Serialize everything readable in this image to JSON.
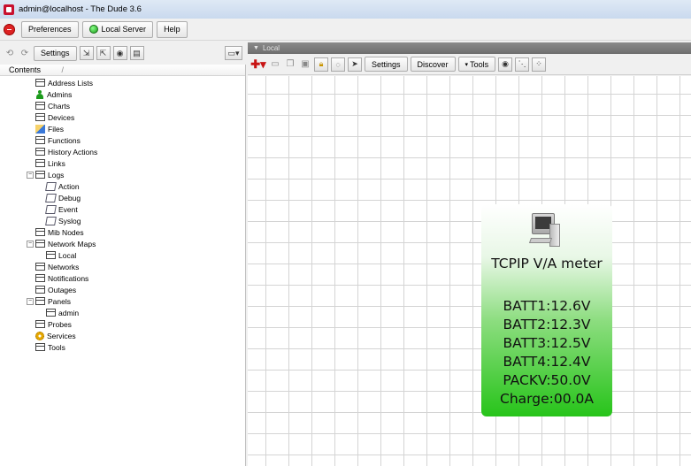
{
  "window": {
    "title": "admin@localhost - The Dude 3.6"
  },
  "menubar": {
    "preferences": "Preferences",
    "local_server": "Local Server",
    "help": "Help"
  },
  "left_toolbar": {
    "settings": "Settings"
  },
  "contents": {
    "header": "Contents",
    "sort_mark": "/",
    "items": [
      {
        "label": "Address Lists",
        "icon": "list-icon",
        "level": 1
      },
      {
        "label": "Admins",
        "icon": "user-icon",
        "level": 1
      },
      {
        "label": "Charts",
        "icon": "list-icon",
        "level": 1
      },
      {
        "label": "Devices",
        "icon": "list-icon",
        "level": 1
      },
      {
        "label": "Files",
        "icon": "files-icon",
        "level": 1
      },
      {
        "label": "Functions",
        "icon": "list-icon",
        "level": 1
      },
      {
        "label": "History Actions",
        "icon": "list-icon",
        "level": 1
      },
      {
        "label": "Links",
        "icon": "list-icon",
        "level": 1
      },
      {
        "label": "Logs",
        "icon": "list-icon",
        "level": 1,
        "expander": "−"
      },
      {
        "label": "Action",
        "icon": "log-icon",
        "level": 2
      },
      {
        "label": "Debug",
        "icon": "log-icon",
        "level": 2
      },
      {
        "label": "Event",
        "icon": "log-icon",
        "level": 2
      },
      {
        "label": "Syslog",
        "icon": "log-icon",
        "level": 2
      },
      {
        "label": "Mib Nodes",
        "icon": "list-icon",
        "level": 1
      },
      {
        "label": "Network Maps",
        "icon": "list-icon",
        "level": 1,
        "expander": "−"
      },
      {
        "label": "Local",
        "icon": "list-icon",
        "level": 2
      },
      {
        "label": "Networks",
        "icon": "list-icon",
        "level": 1
      },
      {
        "label": "Notifications",
        "icon": "list-icon",
        "level": 1
      },
      {
        "label": "Outages",
        "icon": "list-icon",
        "level": 1
      },
      {
        "label": "Panels",
        "icon": "list-icon",
        "level": 1,
        "expander": "−"
      },
      {
        "label": "admin",
        "icon": "list-icon",
        "level": 2
      },
      {
        "label": "Probes",
        "icon": "list-icon",
        "level": 1
      },
      {
        "label": "Services",
        "icon": "gear-icon",
        "level": 1
      },
      {
        "label": "Tools",
        "icon": "list-icon",
        "level": 1
      }
    ]
  },
  "map": {
    "title": "Local",
    "toolbar": {
      "settings": "Settings",
      "discover": "Discover",
      "tools": "Tools"
    },
    "device": {
      "name": "TCPIP V/A meter",
      "lines": [
        "BATT1:12.6V",
        "BATT2:12.3V",
        "BATT3:12.5V",
        "BATT4:12.4V",
        "PACKV:50.0V",
        "Charge:00.0A"
      ],
      "colors": {
        "top": "#ffffff",
        "bottom": "#27c41a"
      }
    }
  }
}
